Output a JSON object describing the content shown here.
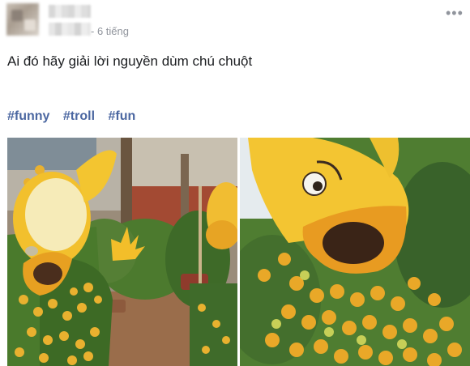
{
  "post": {
    "time": "- 6 tiếng",
    "text": "Ai đó hãy giải lời nguyền dùm chú chuột",
    "hashtags": [
      "#funny",
      "#troll",
      "#fun"
    ]
  },
  "icons": {
    "more": "more-options-icon"
  },
  "colors": {
    "link": "#4b67a1",
    "meta": "#90949c",
    "sculpture_yellow": "#f5c12a",
    "leaf_green": "#3f6b2a",
    "fruit_orange": "#e79b25"
  }
}
